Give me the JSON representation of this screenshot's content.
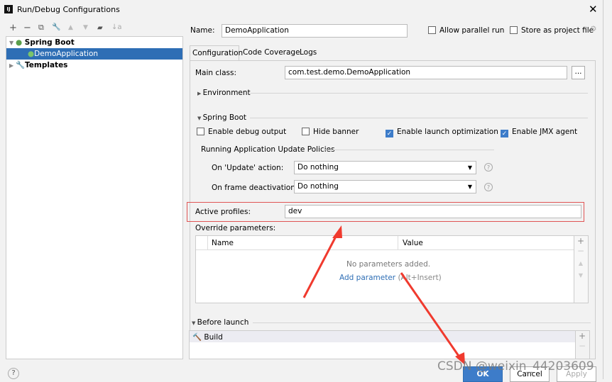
{
  "window": {
    "title": "Run/Debug Configurations",
    "logo": "IJ"
  },
  "toolbar": {
    "add": "+",
    "remove": "−",
    "copy": "⧉",
    "wrench": "🔧",
    "up": "▲",
    "down": "▼",
    "folder": "▰",
    "sort": "↓a"
  },
  "tree": {
    "group": "Spring Boot",
    "item": "DemoApplication",
    "templates": "Templates"
  },
  "form": {
    "name_label": "Name:",
    "name_value": "DemoApplication",
    "allow_parallel": "Allow parallel run",
    "store_project": "Store as project file",
    "tabs": [
      "Configuration",
      "Code Coverage",
      "Logs"
    ],
    "main_class_label": "Main class:",
    "main_class_value": "com.test.demo.DemoApplication",
    "browse": "...",
    "environment": "Environment",
    "spring_boot": "Spring Boot",
    "checks": [
      {
        "label": "Enable debug output",
        "checked": false
      },
      {
        "label": "Hide banner",
        "checked": false
      },
      {
        "label": "Enable launch optimization",
        "checked": true
      },
      {
        "label": "Enable JMX agent",
        "checked": true
      }
    ],
    "policies_title": "Running Application Update Policies",
    "update_label": "On 'Update' action:",
    "update_value": "Do nothing",
    "frame_label": "On frame deactivation:",
    "frame_value": "Do nothing",
    "profiles_label": "Active profiles:",
    "profiles_value": "dev",
    "override_label": "Override parameters:",
    "col_name": "Name",
    "col_value": "Value",
    "empty": "No parameters added.",
    "add_param": "Add parameter",
    "add_param_hint": "(Alt+Insert)",
    "before_launch": "Before launch",
    "build": "Build"
  },
  "buttons": {
    "ok": "OK",
    "cancel": "Cancel",
    "apply": "Apply",
    "help": "?"
  },
  "watermark": "CSDN @weixin_44203609",
  "colors": {
    "accent": "#3d7cc9",
    "highlight": "#e05555",
    "arrow": "#f03a2e"
  }
}
